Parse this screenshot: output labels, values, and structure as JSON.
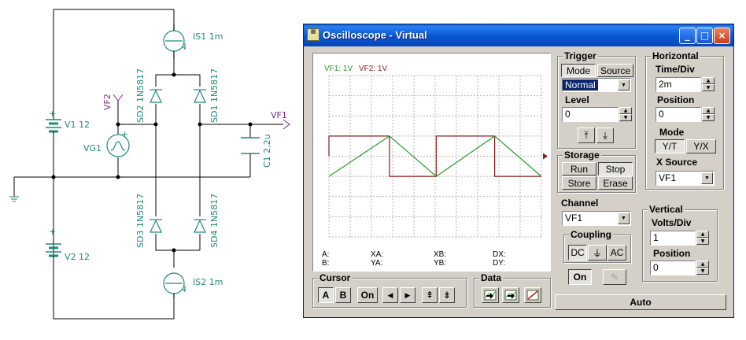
{
  "schematic": {
    "labels": {
      "is1": "IS1 1m",
      "is2": "IS2 1m",
      "sd1": "SD1 1N5817",
      "sd2": "SD2 1N5817",
      "sd3": "SD3 1N5817",
      "sd4": "SD4 1N5817",
      "v1": "V1 12",
      "v2": "V2 12",
      "vg1": "VG1",
      "c1": "C1 2,2u",
      "vf1": "VF1",
      "vf2": "VF2",
      "plus": "+"
    }
  },
  "window": {
    "title": "Oscilloscope - Virtual",
    "minimize": "_",
    "maximize": "□",
    "close": "×"
  },
  "screen": {
    "legend_vf1": "VF1: 1V",
    "legend_vf2": "VF2: 1V",
    "measurements": {
      "a": "A:",
      "b": "B:",
      "xa": "XA:",
      "ya": "YA:",
      "xb": "XB:",
      "yb": "YB:",
      "dx": "DX:",
      "dy": "DY:"
    }
  },
  "trigger": {
    "title": "Trigger",
    "mode": "Mode",
    "source": "Source",
    "mode_value": "Normal",
    "level_label": "Level",
    "level_value": "0"
  },
  "horizontal": {
    "title": "Horizontal",
    "time_div_label": "Time/Div",
    "time_div_value": "2m",
    "position_label": "Position",
    "position_value": "0",
    "mode_label": "Mode",
    "yt": "Y/T",
    "yx": "Y/X",
    "xsource_label": "X Source",
    "xsource_value": "VF1"
  },
  "storage": {
    "title": "Storage",
    "run": "Run",
    "stop": "Stop",
    "store": "Store",
    "erase": "Erase"
  },
  "channel": {
    "title": "Channel",
    "value": "VF1",
    "coupling_title": "Coupling",
    "dc": "DC",
    "gnd": "⏚",
    "ac": "AC",
    "on": "On"
  },
  "vertical": {
    "title": "Vertical",
    "volts_div_label": "Volts/Div",
    "volts_div_value": "1",
    "position_label": "Position",
    "position_value": "0"
  },
  "cursor": {
    "title": "Cursor",
    "a": "A",
    "b": "B",
    "on": "On",
    "left": "◀",
    "right": "▶",
    "up": "⇞",
    "down": "⇟"
  },
  "data": {
    "title": "Data"
  },
  "auto": "Auto",
  "colors": {
    "vf1": "#2a9a2a",
    "vf2": "#8b1a1a",
    "grid": "#b4b4b4"
  }
}
